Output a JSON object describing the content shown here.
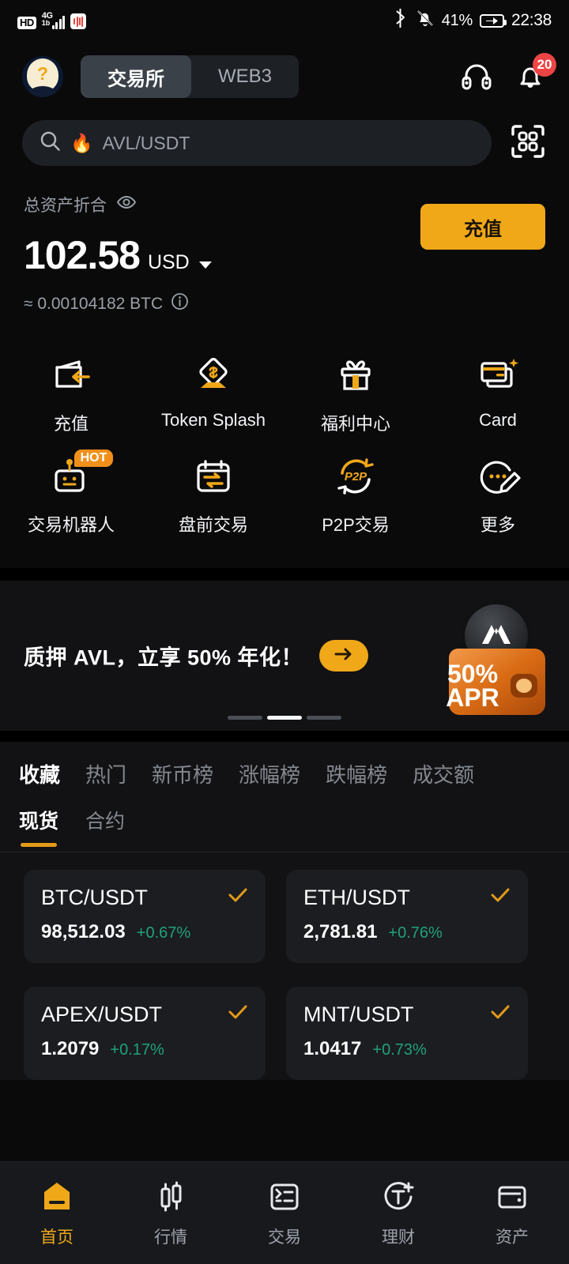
{
  "status_bar": {
    "hd": "HD",
    "network": "4G",
    "network_sub": "1b",
    "battery_percent": "41%",
    "time": "22:38",
    "icons": [
      "hd-badge",
      "signal-bars-icon",
      "red-app-icon",
      "bluetooth-icon",
      "bell-muted-icon",
      "battery-charging-icon"
    ]
  },
  "header": {
    "avatar": "avatar-question",
    "tabs": [
      {
        "label": "交易所",
        "active": true
      },
      {
        "label": "WEB3",
        "active": false
      }
    ],
    "support_icon": "headset-icon",
    "notification_icon": "bell-icon",
    "notification_count": "20"
  },
  "search": {
    "placeholder": "AVL/USDT",
    "hot_emoji": "🔥",
    "search_icon": "search-icon",
    "scan_icon": "qr-scan-icon"
  },
  "balance": {
    "label": "总资产折合",
    "eye_icon": "eye-icon",
    "amount": "102.58",
    "currency": "USD",
    "currency_caret": "chevron-down-icon",
    "btc_equiv": "≈ 0.00104182 BTC",
    "info_icon": "info-icon",
    "deposit_label": "充值",
    "deposit_color": "#f0a819"
  },
  "quick_actions": [
    {
      "label": "充值",
      "icon": "wallet-deposit-icon",
      "badge": ""
    },
    {
      "label": "Token Splash",
      "icon": "token-splash-icon",
      "badge": ""
    },
    {
      "label": "福利中心",
      "icon": "gift-box-icon",
      "badge": ""
    },
    {
      "label": "Card",
      "icon": "credit-card-icon",
      "badge": ""
    },
    {
      "label": "交易机器人",
      "icon": "trading-bot-icon",
      "badge": "HOT"
    },
    {
      "label": "盘前交易",
      "icon": "calendar-swap-icon",
      "badge": ""
    },
    {
      "label": "P2P交易",
      "icon": "p2p-icon",
      "badge": ""
    },
    {
      "label": "更多",
      "icon": "more-edit-icon",
      "badge": ""
    }
  ],
  "banner": {
    "text": "质押 AVL，立享 50% 年化！",
    "arrow_icon": "arrow-right-icon",
    "art_title": "50%",
    "art_subtitle": "APR",
    "art_coin": "AVL",
    "carousel_total": 3,
    "carousel_active": 2
  },
  "market": {
    "category_tabs": [
      {
        "label": "收藏",
        "active": true
      },
      {
        "label": "热门",
        "active": false
      },
      {
        "label": "新币榜",
        "active": false
      },
      {
        "label": "涨幅榜",
        "active": false
      },
      {
        "label": "跌幅榜",
        "active": false
      },
      {
        "label": "成交额",
        "active": false
      }
    ],
    "type_tabs": [
      {
        "label": "现货",
        "active": true
      },
      {
        "label": "合约",
        "active": false
      }
    ],
    "accent_color": "#e29a19",
    "up_color": "#21a179",
    "pairs": [
      {
        "pair": "BTC/USDT",
        "price": "98,512.03",
        "change": "+0.67%",
        "favorite_icon": "check-icon"
      },
      {
        "pair": "ETH/USDT",
        "price": "2,781.81",
        "change": "+0.76%",
        "favorite_icon": "check-icon"
      },
      {
        "pair": "APEX/USDT",
        "price": "1.2079",
        "change": "+0.17%",
        "favorite_icon": "check-icon"
      },
      {
        "pair": "MNT/USDT",
        "price": "1.0417",
        "change": "+0.73%",
        "favorite_icon": "check-icon"
      }
    ]
  },
  "bottom_nav": [
    {
      "label": "首页",
      "icon": "home-icon",
      "active": true
    },
    {
      "label": "行情",
      "icon": "candlestick-icon",
      "active": false
    },
    {
      "label": "交易",
      "icon": "trade-list-icon",
      "active": false
    },
    {
      "label": "理财",
      "icon": "earn-icon",
      "active": false
    },
    {
      "label": "资产",
      "icon": "assets-wallet-icon",
      "active": false
    }
  ]
}
